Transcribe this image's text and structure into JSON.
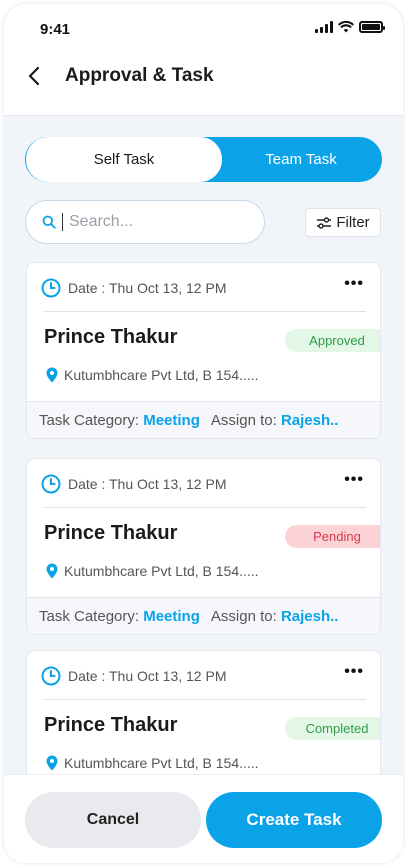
{
  "status_bar": {
    "time": "9:41"
  },
  "header": {
    "title": "Approval & Task"
  },
  "tabs": {
    "self": "Self Task",
    "team": "Team Task",
    "active": "Team Task"
  },
  "search": {
    "placeholder": "Search..."
  },
  "filter": {
    "label": "Filter"
  },
  "colors": {
    "accent": "#0aa3e8",
    "approved": "#2f9c4a",
    "pending": "#d6394b"
  },
  "tasks": [
    {
      "date": "Date : Thu Oct 13, 12 PM",
      "more": "•••",
      "name": "Prince Thakur",
      "status": "Approved",
      "location": "Kutumbhcare Pvt Ltd, B 154.....",
      "category_label": "Task Category:",
      "category": "Meeting",
      "assign_label": "Assign to:",
      "assignee": "Rajesh.."
    },
    {
      "date": "Date : Thu Oct 13, 12 PM",
      "more": "•••",
      "name": "Prince Thakur",
      "status": "Pending",
      "location": "Kutumbhcare Pvt Ltd, B 154.....",
      "category_label": "Task Category:",
      "category": "Meeting",
      "assign_label": "Assign to:",
      "assignee": "Rajesh.."
    },
    {
      "date": "Date : Thu Oct 13, 12 PM",
      "more": "•••",
      "name": "Prince Thakur",
      "status": "Completed",
      "location": "Kutumbhcare Pvt Ltd, B 154.....",
      "category_label": "",
      "category": "",
      "assign_label": "",
      "assignee": ""
    }
  ],
  "actions": {
    "cancel": "Cancel",
    "create": "Create Task"
  }
}
